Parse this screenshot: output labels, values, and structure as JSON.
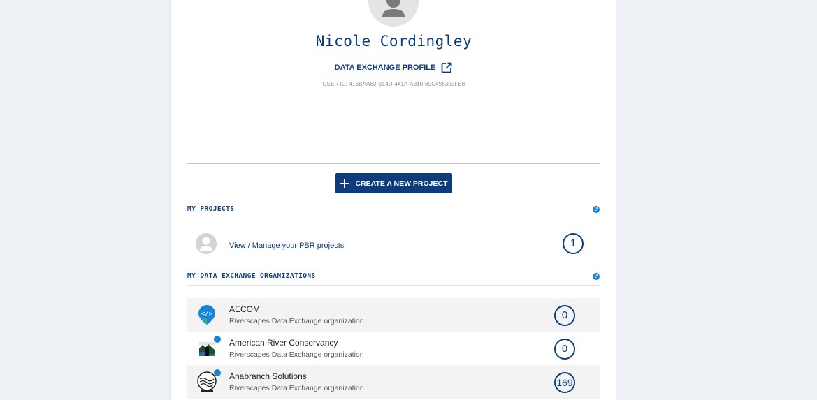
{
  "profile": {
    "name": "Nicole Cordingley",
    "exchange_link_label": "DATA EXCHANGE PROFILE",
    "user_id": "USER ID: 416BAA63-B14D-441A-A310-69C496303FB8"
  },
  "actions": {
    "create_project_label": "CREATE A NEW PROJECT"
  },
  "my_projects": {
    "title": "MY PROJECTS",
    "help_label": "?",
    "items": [
      {
        "label": "View / Manage your PBR projects",
        "count": "1"
      }
    ]
  },
  "my_orgs": {
    "title": "MY DATA EXCHANGE ORGANIZATIONS",
    "help_label": "?",
    "items": [
      {
        "name": "AECOM",
        "type": "Riverscapes Data Exchange organization",
        "count": "0"
      },
      {
        "name": "American River Conservancy",
        "type": "Riverscapes Data Exchange organization",
        "count": "0"
      },
      {
        "name": "Anabranch Solutions",
        "type": "Riverscapes Data Exchange organization",
        "count": "169"
      }
    ]
  },
  "colors": {
    "brand": "#0d3b7c",
    "help": "#1a83d6",
    "page_bg": "#edf0f4"
  },
  "icons": {
    "avatar": "person-avatar-icon",
    "external_link": "external-link-icon",
    "plus": "plus-icon",
    "help": "help-icon"
  }
}
